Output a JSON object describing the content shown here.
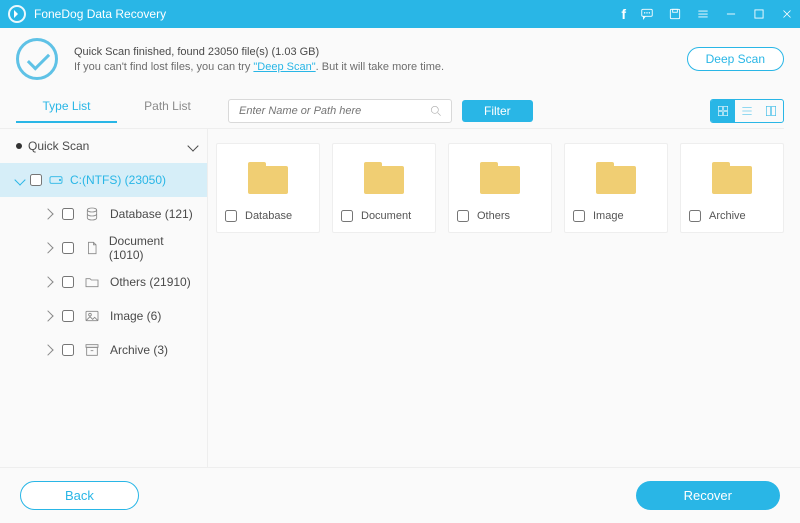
{
  "colors": {
    "accent": "#29b6e6"
  },
  "title": "FoneDog Data Recovery",
  "status": {
    "line1": "Quick Scan finished, found 23050 file(s) (1.03 GB)",
    "line2a": "If you can't find lost files, you can try ",
    "line2_link": "\"Deep Scan\"",
    "line2b": ". But it will take more time.",
    "deep_scan_label": "Deep Scan"
  },
  "tabs": {
    "type_list": "Type List",
    "path_list": "Path List"
  },
  "search": {
    "placeholder": "Enter Name or Path here"
  },
  "filter_label": "Filter",
  "sidebar": {
    "root_label": "Quick Scan",
    "drive_label": "C:(NTFS) (23050)",
    "items": [
      {
        "label": "Database (121)"
      },
      {
        "label": "Document (1010)"
      },
      {
        "label": "Others (21910)"
      },
      {
        "label": "Image (6)"
      },
      {
        "label": "Archive (3)"
      }
    ]
  },
  "folders": [
    {
      "label": "Database"
    },
    {
      "label": "Document"
    },
    {
      "label": "Others"
    },
    {
      "label": "Image"
    },
    {
      "label": "Archive"
    }
  ],
  "footer": {
    "back": "Back",
    "recover": "Recover"
  }
}
